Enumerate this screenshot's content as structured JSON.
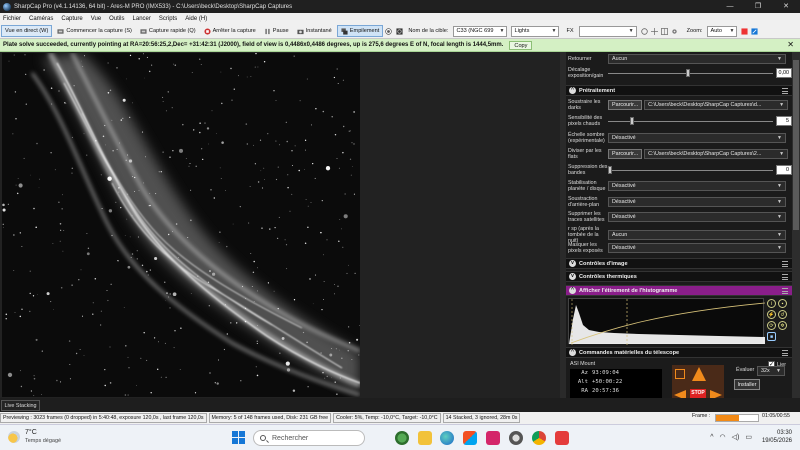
{
  "window": {
    "title": "SharpCap Pro (v4.1.14136, 64 bit) - Ares-M PRO (IMX533) - C:\\Users\\beck\\Desktop\\SharpCap Captures",
    "buttons": [
      "—",
      "❐",
      "✕"
    ]
  },
  "menu": [
    "Fichier",
    "Caméras",
    "Capture",
    "Vue",
    "Outils",
    "Lancer",
    "Scripts",
    "Aide (H)"
  ],
  "toolbar": {
    "live_view": "Vue en direct (W)",
    "start_capture": "Commencer la capture (S)",
    "quick_capture": "Capture rapide (Q)",
    "stop_capture": "Arrêter la capture",
    "pause": "Pause",
    "snapshot": "Instantané",
    "stacking": "Empilement",
    "target_label": "Nom de la cible:",
    "target_value": "C33 (NGC 699",
    "frame_type": "Lights",
    "fx_label": "FX",
    "zoom_label": "Zoom:",
    "zoom_value": "Auto"
  },
  "notification": {
    "text": "Plate solve succeeded, currently pointing at RA=20:56:25,2,Dec= +31:42:31 (J2000), field of view is 0,4486x0,4486 degrees, up is 275,6 degrees E of N, focal length is 1444,5mm.",
    "copy_label": "Copy"
  },
  "panel": {
    "retourner_label": "Retourner",
    "retourner_value": "Aucun",
    "decalage_label": "Décalage exposition/gain",
    "decalage_value": "0,00",
    "pretraitement_title": "Prétraitement",
    "darks_label": "Soustraire les darks",
    "darks_button": "Parcourir...",
    "darks_path": "C:\\Users\\beck\\Desktop\\SharpCap Captures\\d...",
    "hotpix_label": "Sensibilité des pixels chauds",
    "hotpix_value": "5",
    "dark_scale_label": "Échelle sombre (expérimentale)",
    "dark_scale_value": "Désactivé",
    "flats_label": "Diviser par les flats",
    "flats_button": "Parcourir...",
    "flats_path": "C:\\Users\\beck\\Desktop\\SharpCap Captures\\2...",
    "banding_label": "Suppression des bandes",
    "banding_value": "0",
    "stabilise_label": "Stabilisation planète / disque",
    "stabilise_value": "Désactivé",
    "bg_sub_label": "Soustraction d'arrière-plan",
    "bg_sub_value": "Désactivé",
    "sat_label": "Supprimer les traces satellites",
    "sat_value": "Désactivé",
    "fall_label": "r sp (après la tombée de la nuit)",
    "fall_value": "Aucun",
    "mask_label": "Masquer les pixels exposés",
    "mask_value": "Désactivé",
    "image_controls": "Contrôles d'image",
    "thermal_controls": "Contrôles thermiques",
    "histogram_title": "Afficher l'étirement de l'histogramme",
    "telescope_title": "Commandes matérielles du télescope",
    "lier_label": "Lier",
    "mount_name": "ASI Mount",
    "az_label": "Az",
    "az_value": "93:09:04",
    "alt_label": "Alt",
    "alt_value": "+50:00:22",
    "ra_label": "RA",
    "ra_value": "20:57:36",
    "evaluer_label": "Évaluer",
    "evaluer_value": "32x",
    "installer_label": "Installer",
    "stop_label": "STOP"
  },
  "live_stacking_tab": "Live Stacking",
  "status": {
    "previewing": "Previewing : 3023 frames (0 dropped) in 5:40:48, exposure 120,0s , last frame 120,0s",
    "memory": "Memory: 5 of 148 frames used, Disk: 231 GB free",
    "cooler": "Cooler: 5%, Temp: -10,0°C, Target: -10,0°C",
    "stacked": "14 Stacked, 3 ignored, 28m 0s",
    "frame_label": "Frame :",
    "frame_time": "01:05/00:55",
    "frame_progress": 0.55
  },
  "taskbar": {
    "temperature": "7°C",
    "weather": "Temps dégagé",
    "search": "Rechercher",
    "time": "03:30",
    "date": "19/05/2026"
  },
  "colors": {
    "accent": "#8a1e8a",
    "notif_bg": "#d4f0c4",
    "telescope_orange": "#f08a1c"
  }
}
